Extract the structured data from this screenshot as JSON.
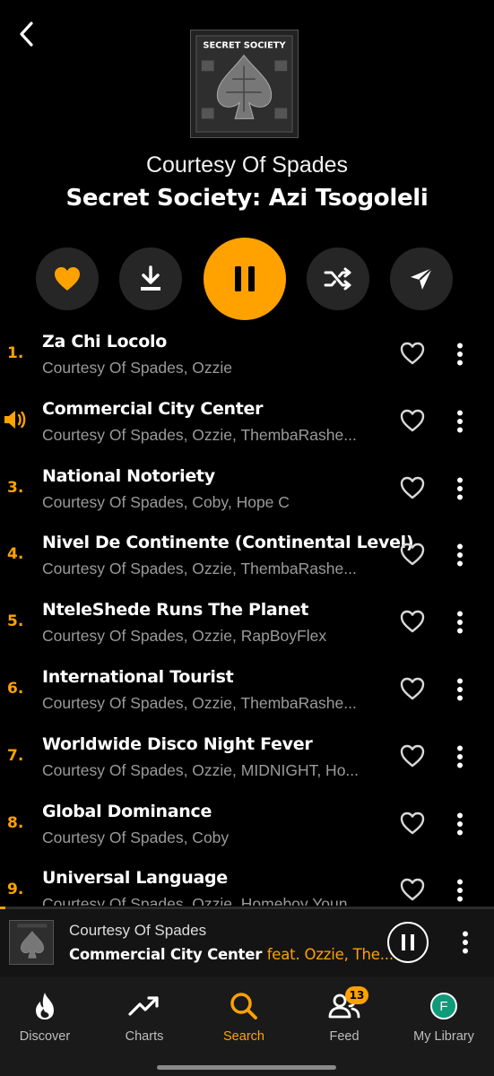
{
  "header": {
    "back_icon": "chevron-left-icon",
    "artist": "Courtesy Of Spades",
    "album": "Secret Society: Azi Tsogoleli",
    "cover_text": "SECRET SOCIETY"
  },
  "controls": {
    "like_icon": "heart-filled-icon",
    "download_icon": "download-icon",
    "play_state_icon": "pause-icon",
    "shuffle_icon": "shuffle-icon",
    "share_icon": "send-icon"
  },
  "colors": {
    "accent": "#ffa200",
    "background": "#000000",
    "subtext": "#9a9a9a"
  },
  "tracks": [
    {
      "num": "1.",
      "title": "Za Chi Locolo",
      "artists": "Courtesy Of Spades, Ozzie",
      "playing": false
    },
    {
      "num": "",
      "title": "Commercial City Center",
      "artists": "Courtesy Of Spades, Ozzie, ThembaRashe...",
      "playing": true
    },
    {
      "num": "3.",
      "title": "National Notoriety",
      "artists": "Courtesy Of Spades, Coby, Hope C",
      "playing": false
    },
    {
      "num": "4.",
      "title": "Nivel De Continente (Continental Level)",
      "artists": "Courtesy Of Spades, Ozzie, ThembaRashe...",
      "playing": false
    },
    {
      "num": "5.",
      "title": "NteleShede Runs The Planet",
      "artists": "Courtesy Of Spades, Ozzie, RapBoyFlex",
      "playing": false
    },
    {
      "num": "6.",
      "title": "International Tourist",
      "artists": "Courtesy Of Spades, Ozzie, ThembaRashe...",
      "playing": false
    },
    {
      "num": "7.",
      "title": "Worldwide Disco Night Fever",
      "artists": "Courtesy Of Spades, Ozzie, MIDNIGHT, Ho...",
      "playing": false
    },
    {
      "num": "8.",
      "title": "Global Dominance",
      "artists": "Courtesy Of Spades, Coby",
      "playing": false
    },
    {
      "num": "9.",
      "title": "Universal Language",
      "artists": "Courtesy Of Spades, Ozzie, Homeboy Youn...",
      "playing": false
    }
  ],
  "now_playing": {
    "artist": "Courtesy Of Spades",
    "title": "Commercial City Center",
    "feat": "feat. Ozzie, The...",
    "progress": 0.01
  },
  "nav": {
    "items": [
      {
        "label": "Discover",
        "icon": "flame-icon"
      },
      {
        "label": "Charts",
        "icon": "trending-up-icon"
      },
      {
        "label": "Search",
        "icon": "search-icon"
      },
      {
        "label": "Feed",
        "icon": "people-icon",
        "badge": "13"
      },
      {
        "label": "My Library",
        "icon": "avatar-icon",
        "avatar_letter": "F"
      }
    ],
    "active": "Search"
  }
}
